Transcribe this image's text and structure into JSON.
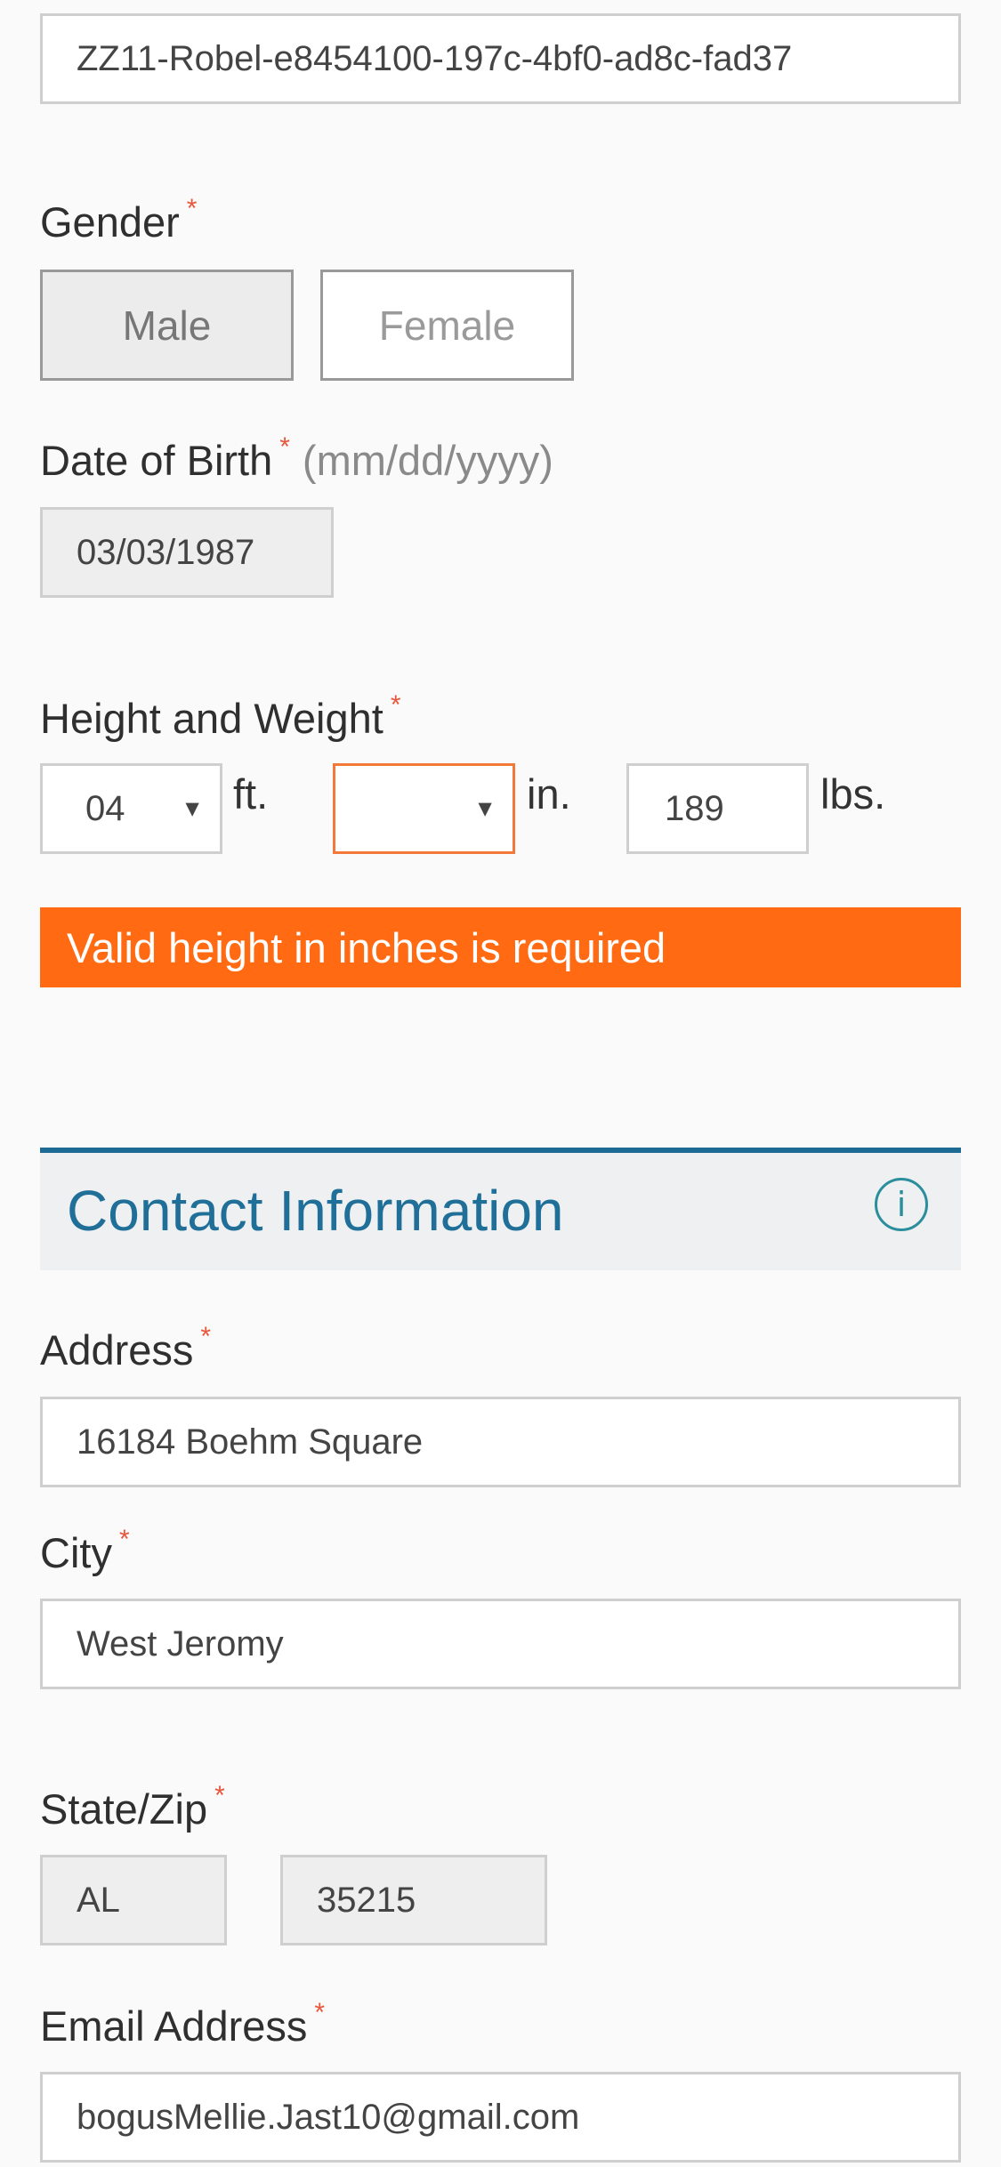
{
  "member_id": {
    "value": "ZZ11-Robel-e8454100-197c-4bf0-ad8c-fad37"
  },
  "gender": {
    "label": "Gender",
    "required_mark": "*",
    "options": [
      "Male",
      "Female"
    ],
    "selected": "Male"
  },
  "dob": {
    "label": "Date of Birth",
    "required_mark": "*",
    "hint": "(mm/dd/yyyy)",
    "value": "03/03/1987"
  },
  "height_weight": {
    "label": "Height and Weight",
    "required_mark": "*",
    "feet_value": "04",
    "feet_unit": "ft.",
    "inches_value": "",
    "inches_unit": "in.",
    "weight_value": "189",
    "weight_unit": "lbs.",
    "error_message": "Valid height in inches is required"
  },
  "contact": {
    "section_title": "Contact Information",
    "info_glyph": "i",
    "address": {
      "label": "Address",
      "required_mark": "*",
      "value": "16184 Boehm Square"
    },
    "city": {
      "label": "City",
      "required_mark": "*",
      "value": "West Jeromy"
    },
    "state_zip": {
      "label": "State/Zip",
      "required_mark": "*",
      "state_value": "AL",
      "zip_value": "35215"
    },
    "email": {
      "label": "Email Address",
      "required_mark": "*",
      "value": "bogusMellie.Jast10@gmail.com"
    }
  },
  "icons": {
    "select_caret": "caret-down-icon",
    "info": "info-icon"
  },
  "colors": {
    "error": "#ff6a13",
    "required_asterisk": "#e8563c",
    "section_accent": "#1d6b94",
    "info_icon": "#2a8e9c"
  }
}
